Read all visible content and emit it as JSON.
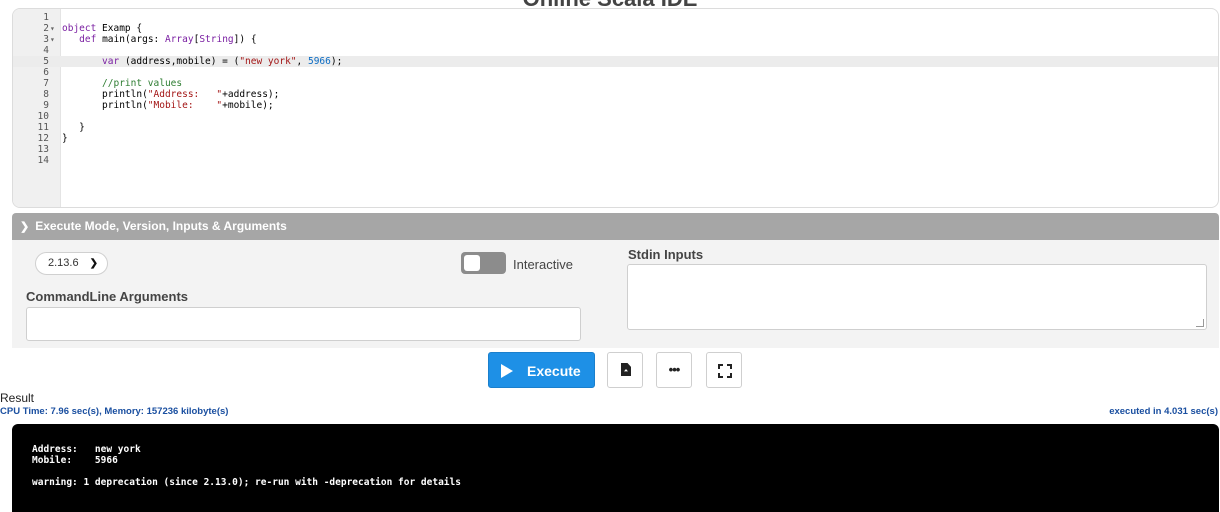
{
  "page": {
    "title_fragment": "Online Scala IDE"
  },
  "editor": {
    "lines": [
      {
        "n": "1",
        "fold": "",
        "tokens": []
      },
      {
        "n": "2",
        "fold": "▾",
        "tokens": [
          {
            "t": "kw",
            "v": "object"
          },
          {
            "t": "",
            "v": " Examp {"
          }
        ]
      },
      {
        "n": "3",
        "fold": "▾",
        "tokens": [
          {
            "t": "",
            "v": "   "
          },
          {
            "t": "kw",
            "v": "def"
          },
          {
            "t": "",
            "v": " main(args: "
          },
          {
            "t": "ty",
            "v": "Array"
          },
          {
            "t": "",
            "v": "["
          },
          {
            "t": "ty",
            "v": "String"
          },
          {
            "t": "",
            "v": "]) {"
          }
        ]
      },
      {
        "n": "4",
        "fold": "",
        "tokens": []
      },
      {
        "n": "5",
        "fold": "",
        "active": true,
        "tokens": [
          {
            "t": "",
            "v": "       "
          },
          {
            "t": "kw",
            "v": "var"
          },
          {
            "t": "",
            "v": " (address,mobile) = ("
          },
          {
            "t": "str",
            "v": "\"new york\""
          },
          {
            "t": "",
            "v": ", "
          },
          {
            "t": "num",
            "v": "5966"
          },
          {
            "t": "",
            "v": ");"
          }
        ]
      },
      {
        "n": "6",
        "fold": "",
        "tokens": []
      },
      {
        "n": "7",
        "fold": "",
        "tokens": [
          {
            "t": "",
            "v": "       "
          },
          {
            "t": "cm",
            "v": "//print values"
          }
        ]
      },
      {
        "n": "8",
        "fold": "",
        "tokens": [
          {
            "t": "",
            "v": "       println("
          },
          {
            "t": "str",
            "v": "\"Address:   \""
          },
          {
            "t": "",
            "v": "+address);"
          }
        ]
      },
      {
        "n": "9",
        "fold": "",
        "tokens": [
          {
            "t": "",
            "v": "       println("
          },
          {
            "t": "str",
            "v": "\"Mobile:    \""
          },
          {
            "t": "",
            "v": "+mobile);"
          }
        ]
      },
      {
        "n": "10",
        "fold": "",
        "tokens": []
      },
      {
        "n": "11",
        "fold": "",
        "tokens": [
          {
            "t": "",
            "v": "   }"
          }
        ]
      },
      {
        "n": "12",
        "fold": "",
        "tokens": [
          {
            "t": "",
            "v": "}"
          }
        ]
      },
      {
        "n": "13",
        "fold": "",
        "tokens": []
      },
      {
        "n": "14",
        "fold": "",
        "tokens": []
      }
    ]
  },
  "exec_panel": {
    "header": "Execute Mode, Version, Inputs & Arguments",
    "version": "2.13.6",
    "interactive_label": "Interactive",
    "cmd_args_label": "CommandLine Arguments",
    "cmd_args_value": "",
    "stdin_label": "Stdin Inputs",
    "stdin_value": ""
  },
  "toolbar": {
    "execute_label": "Execute"
  },
  "result": {
    "label": "Result",
    "stats": "CPU Time: 7.96 sec(s), Memory: 157236 kilobyte(s)",
    "executed": "executed in 4.031 sec(s)",
    "output_lines": [
      "Address:   new york",
      "Mobile:    5966",
      "",
      "warning: 1 deprecation (since 2.13.0); re-run with -deprecation for details"
    ]
  },
  "colors": {
    "accent": "#1e90e6",
    "panel_header": "#a6a6a6",
    "stats_text": "#1a4fa0",
    "console_bg": "#000000"
  }
}
